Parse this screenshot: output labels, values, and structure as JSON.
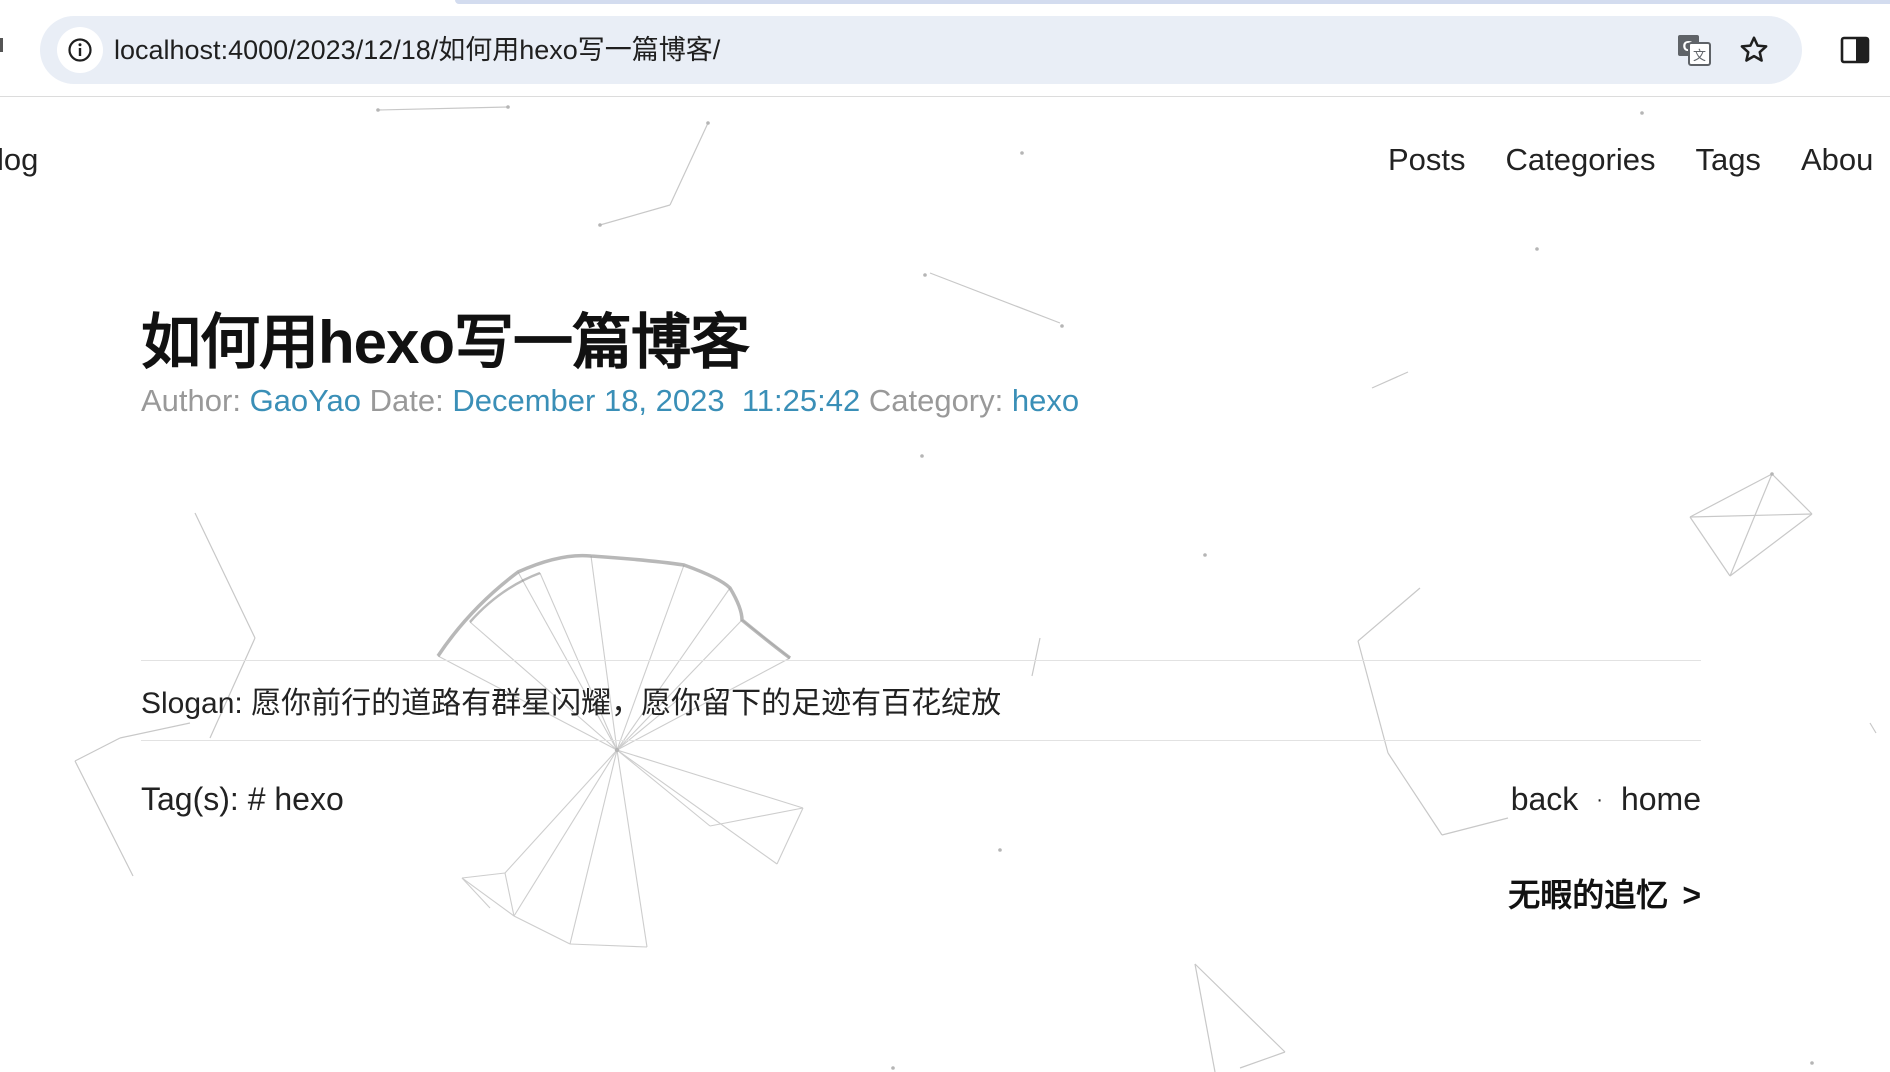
{
  "browser": {
    "url": "localhost:4000/2023/12/18/如何用hexo写一篇博客/"
  },
  "site": {
    "brand": "log",
    "nav": [
      "Posts",
      "Categories",
      "Tags",
      "Abou"
    ]
  },
  "post": {
    "title": "如何用hexo写一篇博客",
    "meta": {
      "author_label": "Author: ",
      "author": "GaoYao",
      "date_label": " Date: ",
      "date": "December 18, 2023",
      "time": "11:25:42",
      "category_label": " Category: ",
      "category": "hexo"
    },
    "slogan": "Slogan: 愿你前行的道路有群星闪耀，愿你留下的足迹有百花绽放",
    "tags_label": "Tag(s): ",
    "tags": [
      "# hexo"
    ],
    "back": "back",
    "separator": "·",
    "home": "home",
    "next_title": "无暇的追忆",
    "next_arrow": ">"
  },
  "colors": {
    "link": "#3a8fb7",
    "meta": "#999999",
    "omnibox": "#e9eef6"
  }
}
